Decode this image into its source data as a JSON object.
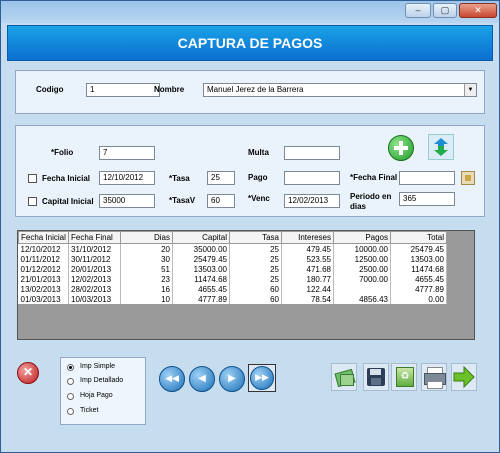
{
  "header": {
    "title": "CAPTURA DE PAGOS"
  },
  "client": {
    "codigo_label": "Codigo",
    "codigo_value": "1",
    "nombre_label": "Nombre",
    "nombre_value": "Manuel Jerez de la Barrera"
  },
  "form": {
    "folio_label": "*Folio",
    "folio_value": "7",
    "multa_label": "Multa",
    "multa_value": "",
    "fecha_inicial_label": "Fecha Inicial",
    "fecha_inicial_value": "12/10/2012",
    "tasa_label": "*Tasa",
    "tasa_value": "25",
    "pago_label": "Pago",
    "pago_value": "",
    "fecha_final_label": "*Fecha Final",
    "fecha_final_value": "",
    "capital_inicial_label": "Capital Inicial",
    "capital_inicial_value": "35000",
    "tasav_label": "*TasaV",
    "tasav_value": "60",
    "venc_label": "*Venc",
    "venc_value": "12/02/2013",
    "periodo_label_1": "Periodo en",
    "periodo_label_2": "dias",
    "periodo_value": "365"
  },
  "table": {
    "columns": [
      "Fecha Inicial",
      "Fecha Final",
      "Dias",
      "Capital",
      "Tasa",
      "Intereses",
      "Pagos",
      "Total"
    ],
    "rows": [
      [
        "12/10/2012",
        "31/10/2012",
        "20",
        "35000.00",
        "25",
        "479.45",
        "10000.00",
        "25479.45"
      ],
      [
        "01/11/2012",
        "30/11/2012",
        "30",
        "25479.45",
        "25",
        "523.55",
        "12500.00",
        "13503.00"
      ],
      [
        "01/12/2012",
        "20/01/2013",
        "51",
        "13503.00",
        "25",
        "471.68",
        "2500.00",
        "11474.68"
      ],
      [
        "21/01/2013",
        "12/02/2013",
        "23",
        "11474.68",
        "25",
        "180.77",
        "7000.00",
        "4655.45"
      ],
      [
        "13/02/2013",
        "28/02/2013",
        "16",
        "4655.45",
        "60",
        "122.44",
        "",
        "4777.89"
      ],
      [
        "01/03/2013",
        "10/03/2013",
        "10",
        "4777.89",
        "60",
        "78.54",
        "4856.43",
        "0.00"
      ]
    ]
  },
  "options": [
    "Imp Simple",
    "Imp Detallado",
    "Hoja Pago",
    "Ticket"
  ],
  "icons": {
    "add": "plus-icon",
    "refresh": "refresh-icon",
    "calendar": "calendar-icon",
    "close": "close-icon",
    "save": "save-icon",
    "recycle": "recycle-icon",
    "print": "printer-icon",
    "next": "arrow-right-icon"
  },
  "colors": {
    "header": "#0b6fd1",
    "background": "#c6ddf0",
    "panel": "#eaf3fb"
  }
}
